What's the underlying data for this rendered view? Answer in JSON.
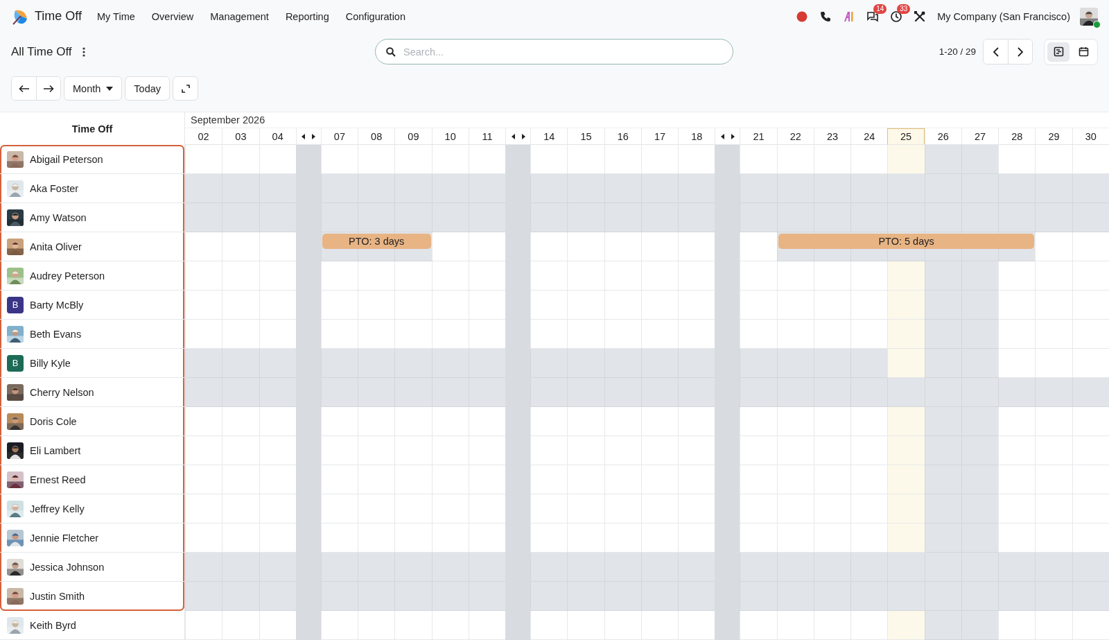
{
  "app": {
    "title": "Time Off"
  },
  "menu": [
    {
      "label": "My Time"
    },
    {
      "label": "Overview"
    },
    {
      "label": "Management"
    },
    {
      "label": "Reporting"
    },
    {
      "label": "Configuration"
    }
  ],
  "systray": [
    {
      "kind": "record"
    },
    {
      "kind": "phone"
    },
    {
      "kind": "ai"
    },
    {
      "kind": "chat",
      "badge": "14"
    },
    {
      "kind": "clock",
      "badge": "33"
    },
    {
      "kind": "tools"
    }
  ],
  "company": "My Company (San Francisco)",
  "user": {
    "online": true
  },
  "breadcrumb": {
    "title": "All Time Off"
  },
  "search": {
    "placeholder": "Search..."
  },
  "pager": {
    "text": "1-20 / 29"
  },
  "views": [
    {
      "kind": "gantt",
      "selected": true
    },
    {
      "kind": "calendar",
      "selected": false
    }
  ],
  "toolbar": {
    "scale": "Month",
    "today": "Today"
  },
  "gantt": {
    "left_title": "Time Off",
    "month": "September 2026",
    "days": [
      {
        "kind": "day",
        "label": "02",
        "today": false
      },
      {
        "kind": "day",
        "label": "03",
        "today": false
      },
      {
        "kind": "day",
        "label": "04",
        "today": false
      },
      {
        "kind": "collapsed"
      },
      {
        "kind": "day",
        "label": "07",
        "today": false
      },
      {
        "kind": "day",
        "label": "08",
        "today": false
      },
      {
        "kind": "day",
        "label": "09",
        "today": false
      },
      {
        "kind": "day",
        "label": "10",
        "today": false
      },
      {
        "kind": "day",
        "label": "11",
        "today": false
      },
      {
        "kind": "collapsed"
      },
      {
        "kind": "day",
        "label": "14",
        "today": false
      },
      {
        "kind": "day",
        "label": "15",
        "today": false
      },
      {
        "kind": "day",
        "label": "16",
        "today": false
      },
      {
        "kind": "day",
        "label": "17",
        "today": false
      },
      {
        "kind": "day",
        "label": "18",
        "today": false
      },
      {
        "kind": "collapsed"
      },
      {
        "kind": "day",
        "label": "21",
        "today": false
      },
      {
        "kind": "day",
        "label": "22",
        "today": false
      },
      {
        "kind": "day",
        "label": "23",
        "today": false
      },
      {
        "kind": "day",
        "label": "24",
        "today": false
      },
      {
        "kind": "day",
        "label": "25",
        "today": true
      },
      {
        "kind": "day",
        "label": "26",
        "today": false
      },
      {
        "kind": "day",
        "label": "27",
        "today": false
      },
      {
        "kind": "day",
        "label": "28",
        "today": false
      },
      {
        "kind": "day",
        "label": "29",
        "today": false
      },
      {
        "kind": "day",
        "label": "30",
        "today": false
      }
    ],
    "rows": [
      {
        "name": "Abigail Peterson",
        "selected": true,
        "off": [
          false,
          false,
          false,
          false,
          false,
          false,
          false,
          false,
          false,
          false,
          false,
          false,
          false,
          false,
          false,
          false,
          false,
          false,
          true,
          true,
          false,
          false,
          false
        ]
      },
      {
        "name": "Aka Foster",
        "selected": true,
        "off": [
          true,
          true,
          true,
          true,
          true,
          true,
          true,
          true,
          true,
          true,
          true,
          true,
          true,
          true,
          true,
          true,
          true,
          true,
          true,
          true,
          true,
          true,
          true
        ]
      },
      {
        "name": "Amy Watson",
        "selected": true,
        "off": [
          true,
          true,
          true,
          true,
          true,
          true,
          true,
          true,
          true,
          true,
          true,
          true,
          true,
          true,
          true,
          true,
          true,
          true,
          true,
          true,
          true,
          true,
          true
        ]
      },
      {
        "name": "Anita Oliver",
        "selected": true,
        "off": [
          false,
          false,
          false,
          true,
          true,
          true,
          false,
          false,
          false,
          false,
          false,
          false,
          false,
          false,
          true,
          true,
          true,
          true,
          true,
          true,
          true,
          false,
          false
        ],
        "on_leave": [
          false,
          false,
          false,
          true,
          true,
          true,
          false,
          false,
          false,
          false,
          false,
          false,
          false,
          false,
          true,
          true,
          true,
          true,
          true,
          true,
          true,
          false,
          false
        ],
        "leaves": [
          {
            "label": "PTO: 3 days"
          },
          {
            "label": "PTO: 5 days"
          }
        ]
      },
      {
        "name": "Audrey Peterson",
        "selected": true,
        "off": [
          false,
          false,
          false,
          false,
          false,
          false,
          false,
          false,
          false,
          false,
          false,
          false,
          false,
          false,
          false,
          false,
          false,
          false,
          true,
          true,
          false,
          false,
          false
        ]
      },
      {
        "name": "Barty McBly",
        "avatar": {
          "kind": "letter",
          "letter": "B",
          "color": "#3b3587"
        },
        "selected": true,
        "off": [
          false,
          false,
          false,
          false,
          false,
          false,
          false,
          false,
          false,
          false,
          false,
          false,
          false,
          false,
          false,
          false,
          false,
          false,
          true,
          true,
          false,
          false,
          false
        ]
      },
      {
        "name": "Beth Evans",
        "selected": true,
        "off": [
          false,
          false,
          false,
          false,
          false,
          false,
          false,
          false,
          false,
          false,
          false,
          false,
          false,
          false,
          false,
          false,
          false,
          false,
          true,
          true,
          false,
          false,
          false
        ]
      },
      {
        "name": "Billy Kyle",
        "avatar": {
          "kind": "letter",
          "letter": "B",
          "color": "#1d6b56"
        },
        "selected": true,
        "off": [
          true,
          true,
          true,
          true,
          true,
          true,
          true,
          true,
          true,
          true,
          true,
          true,
          true,
          true,
          true,
          true,
          true,
          false,
          true,
          true,
          false,
          false,
          false
        ]
      },
      {
        "name": "Cherry Nelson",
        "selected": true,
        "off": [
          true,
          true,
          true,
          true,
          true,
          true,
          true,
          true,
          true,
          true,
          true,
          true,
          true,
          true,
          true,
          true,
          true,
          true,
          true,
          true,
          true,
          true,
          true
        ]
      },
      {
        "name": "Doris Cole",
        "selected": true,
        "off": [
          false,
          false,
          false,
          false,
          false,
          false,
          false,
          false,
          false,
          false,
          false,
          false,
          false,
          false,
          false,
          false,
          false,
          false,
          true,
          true,
          false,
          false,
          false
        ]
      },
      {
        "name": "Eli Lambert",
        "selected": true,
        "off": [
          false,
          false,
          false,
          false,
          false,
          false,
          false,
          false,
          false,
          false,
          false,
          false,
          false,
          false,
          false,
          false,
          false,
          false,
          true,
          true,
          false,
          false,
          false
        ]
      },
      {
        "name": "Ernest Reed",
        "selected": true,
        "off": [
          false,
          false,
          false,
          false,
          false,
          false,
          false,
          false,
          false,
          false,
          false,
          false,
          false,
          false,
          false,
          false,
          false,
          false,
          true,
          true,
          false,
          false,
          false
        ]
      },
      {
        "name": "Jeffrey Kelly",
        "selected": true,
        "off": [
          false,
          false,
          false,
          false,
          false,
          false,
          false,
          false,
          false,
          false,
          false,
          false,
          false,
          false,
          false,
          false,
          false,
          false,
          true,
          true,
          false,
          false,
          false
        ]
      },
      {
        "name": "Jennie Fletcher",
        "selected": true,
        "off": [
          false,
          false,
          false,
          false,
          false,
          false,
          false,
          false,
          false,
          false,
          false,
          false,
          false,
          false,
          false,
          false,
          false,
          false,
          true,
          true,
          false,
          false,
          false
        ]
      },
      {
        "name": "Jessica Johnson",
        "selected": true,
        "off": [
          true,
          true,
          true,
          true,
          true,
          true,
          true,
          true,
          true,
          true,
          true,
          true,
          true,
          true,
          true,
          true,
          true,
          true,
          true,
          true,
          true,
          true,
          true
        ]
      },
      {
        "name": "Justin Smith",
        "selected": true,
        "off": [
          true,
          true,
          true,
          true,
          true,
          true,
          true,
          true,
          true,
          true,
          true,
          true,
          true,
          true,
          true,
          true,
          true,
          true,
          true,
          true,
          true,
          true,
          true
        ]
      },
      {
        "name": "Keith Byrd",
        "selected": false,
        "off": [
          false,
          false,
          false,
          false,
          false,
          false,
          false,
          false,
          false,
          false,
          false,
          false,
          false,
          false,
          false,
          false,
          false,
          false,
          true,
          true,
          false,
          false,
          false
        ]
      }
    ]
  }
}
